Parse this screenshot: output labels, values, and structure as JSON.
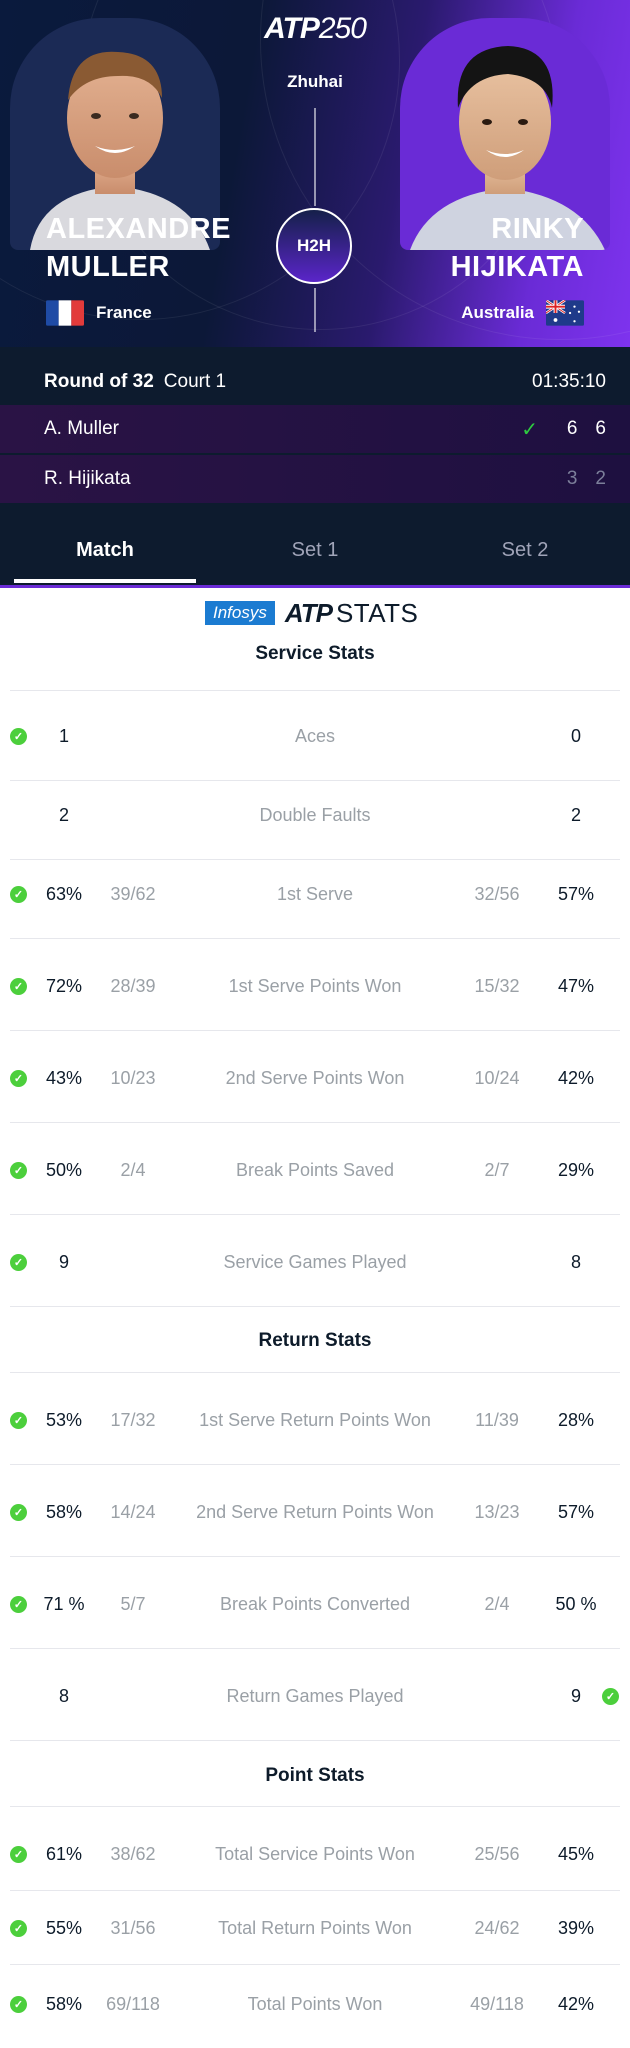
{
  "header": {
    "brand_prefix": "ATP",
    "brand_suffix": "250",
    "city": "Zhuhai",
    "h2h_label": "H2H",
    "player1": {
      "first": "ALEXANDRE",
      "last": "MULLER",
      "country": "France"
    },
    "player2": {
      "first": "RINKY",
      "last": "HIJIKATA",
      "country": "Australia"
    }
  },
  "match": {
    "round": "Round of 32",
    "court": "Court 1",
    "duration": "01:35:10",
    "rows": [
      {
        "name": "A. Muller",
        "winner": true,
        "set1": "6",
        "set2": "6"
      },
      {
        "name": "R. Hijikata",
        "winner": false,
        "set1": "3",
        "set2": "2"
      }
    ]
  },
  "tabs": [
    "Match",
    "Set 1",
    "Set 2"
  ],
  "stats_logo": {
    "infosys": "Infosys",
    "atp": "ATP",
    "stats": "STATS"
  },
  "sections": {
    "service": "Service Stats",
    "return": "Return Stats",
    "point": "Point Stats"
  },
  "stats": [
    {
      "label": "Aces",
      "l": "1",
      "lf": "",
      "r": "0",
      "rf": "",
      "win": "l"
    },
    {
      "label": "Double Faults",
      "l": "2",
      "lf": "",
      "r": "2",
      "rf": "",
      "win": ""
    },
    {
      "label": "1st Serve",
      "l": "63%",
      "lf": "39/62",
      "r": "57%",
      "rf": "32/56",
      "win": "l"
    },
    {
      "label": "1st Serve Points Won",
      "l": "72%",
      "lf": "28/39",
      "r": "47%",
      "rf": "15/32",
      "win": "l"
    },
    {
      "label": "2nd Serve Points Won",
      "l": "43%",
      "lf": "10/23",
      "r": "42%",
      "rf": "10/24",
      "win": "l"
    },
    {
      "label": "Break Points Saved",
      "l": "50%",
      "lf": "2/4",
      "r": "29%",
      "rf": "2/7",
      "win": "l"
    },
    {
      "label": "Service Games Played",
      "l": "9",
      "lf": "",
      "r": "8",
      "rf": "",
      "win": "l"
    },
    {
      "label": "1st Serve Return Points Won",
      "l": "53%",
      "lf": "17/32",
      "r": "28%",
      "rf": "11/39",
      "win": "l"
    },
    {
      "label": "2nd Serve Return Points Won",
      "l": "58%",
      "lf": "14/24",
      "r": "57%",
      "rf": "13/23",
      "win": "l"
    },
    {
      "label": "Break Points Converted",
      "l": "71 %",
      "lf": "5/7",
      "r": "50 %",
      "rf": "2/4",
      "win": "l"
    },
    {
      "label": "Return Games Played",
      "l": "8",
      "lf": "",
      "r": "9",
      "rf": "",
      "win": "r"
    },
    {
      "label": "Total Service Points Won",
      "l": "61%",
      "lf": "38/62",
      "r": "45%",
      "rf": "25/56",
      "win": "l"
    },
    {
      "label": "Total Return Points Won",
      "l": "55%",
      "lf": "31/56",
      "r": "39%",
      "rf": "24/62",
      "win": "l"
    },
    {
      "label": "Total Points Won",
      "l": "58%",
      "lf": "69/118",
      "r": "42%",
      "rf": "49/118",
      "win": "l"
    }
  ],
  "colors": {
    "winner_green": "#4ccf3c",
    "header_navy": "#0d1b2e",
    "accent_purple": "#6a2bd6"
  }
}
